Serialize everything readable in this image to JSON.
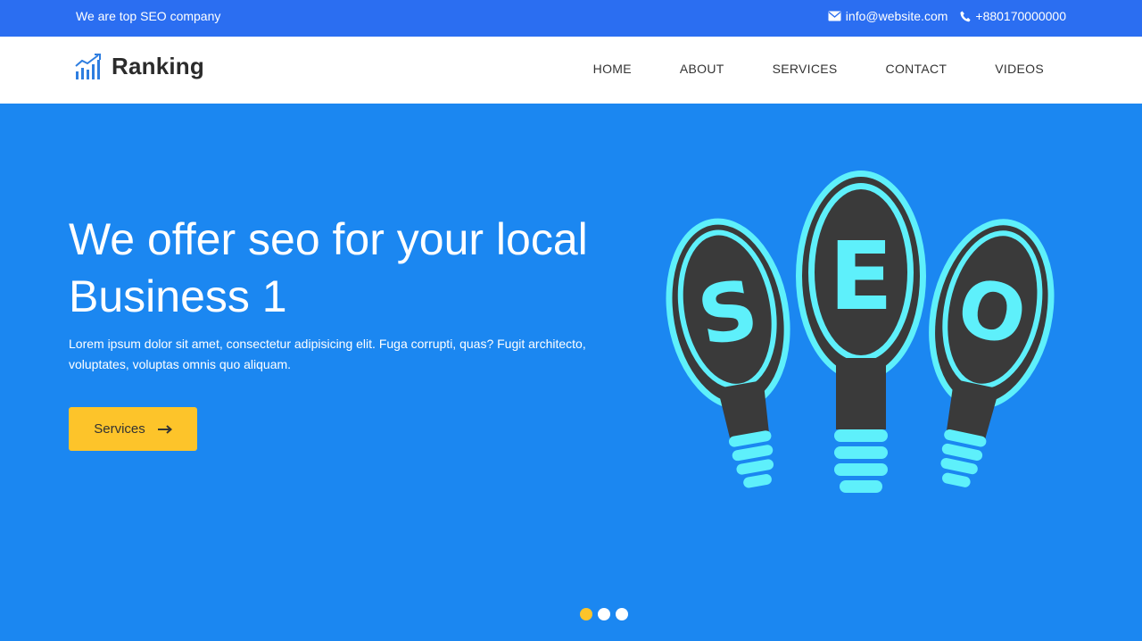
{
  "topbar": {
    "tagline": "We are top SEO company",
    "email": "info@website.com",
    "phone": "+880170000000"
  },
  "header": {
    "logo_text": "Ranking",
    "nav": [
      "HOME",
      "ABOUT",
      "SERVICES",
      "CONTACT",
      "VIDEOS"
    ]
  },
  "hero": {
    "title_line1": "We offer seo for your local",
    "title_line2": "Business 1",
    "text": "Lorem ipsum dolor sit amet, consectetur adipisicing elit. Fuga corrupti, quas? Fugit architecto, voluptates, voluptas omnis quo aliquam.",
    "button_label": "Services",
    "art_letters": [
      "S",
      "E",
      "O"
    ]
  },
  "slider": {
    "count": 3,
    "active_index": 0
  },
  "colors": {
    "topbar": "#2b6ef1",
    "hero": "#1b87f1",
    "button": "#fdc42a",
    "bulb_accent": "#5ef0fb",
    "bulb_dark": "#3a3a3a"
  }
}
